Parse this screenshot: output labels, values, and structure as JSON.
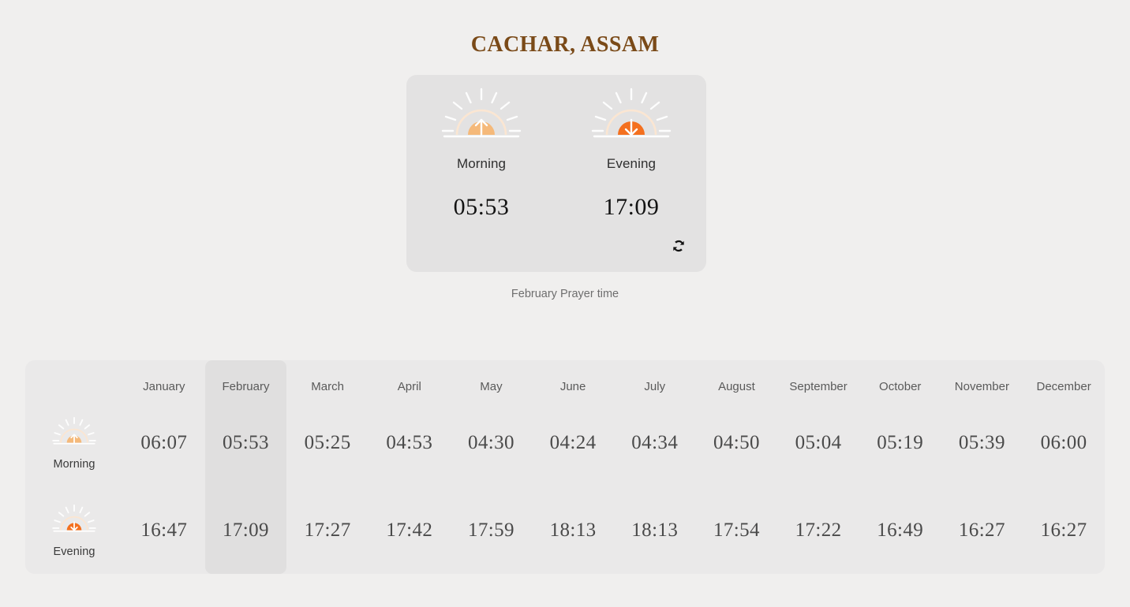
{
  "header": {
    "title": "CACHAR, ASSAM",
    "title_color": "#7A4A18"
  },
  "summary_card": {
    "morning": {
      "icon": "sunrise-icon",
      "label": "Morning",
      "time": "05:53"
    },
    "evening": {
      "icon": "sunset-icon",
      "label": "Evening",
      "time": "17:09"
    },
    "refresh_icon": "refresh-icon",
    "background_color": "#E3E2E2"
  },
  "caption": "February Prayer time",
  "table": {
    "background_color": "#EAE9E9",
    "highlight_color": "#E0DFDF",
    "current_month": "February",
    "current_month_index": 1,
    "months": [
      "January",
      "February",
      "March",
      "April",
      "May",
      "June",
      "July",
      "August",
      "September",
      "October",
      "November",
      "December"
    ],
    "rows": [
      {
        "icon": "sunrise-icon",
        "label": "Morning",
        "times": [
          "06:07",
          "05:53",
          "05:25",
          "04:53",
          "04:30",
          "04:24",
          "04:34",
          "04:50",
          "05:04",
          "05:19",
          "05:39",
          "06:00"
        ]
      },
      {
        "icon": "sunset-icon",
        "label": "Evening",
        "times": [
          "16:47",
          "17:09",
          "17:27",
          "17:42",
          "17:59",
          "18:13",
          "18:13",
          "17:54",
          "17:22",
          "16:49",
          "16:27",
          "16:27"
        ]
      }
    ]
  },
  "colors": {
    "page_background": "#F0EFEE",
    "sunrise_dome": "#F5B97A",
    "sunset_dome": "#F4701F",
    "rays": "#FFFFFF"
  }
}
